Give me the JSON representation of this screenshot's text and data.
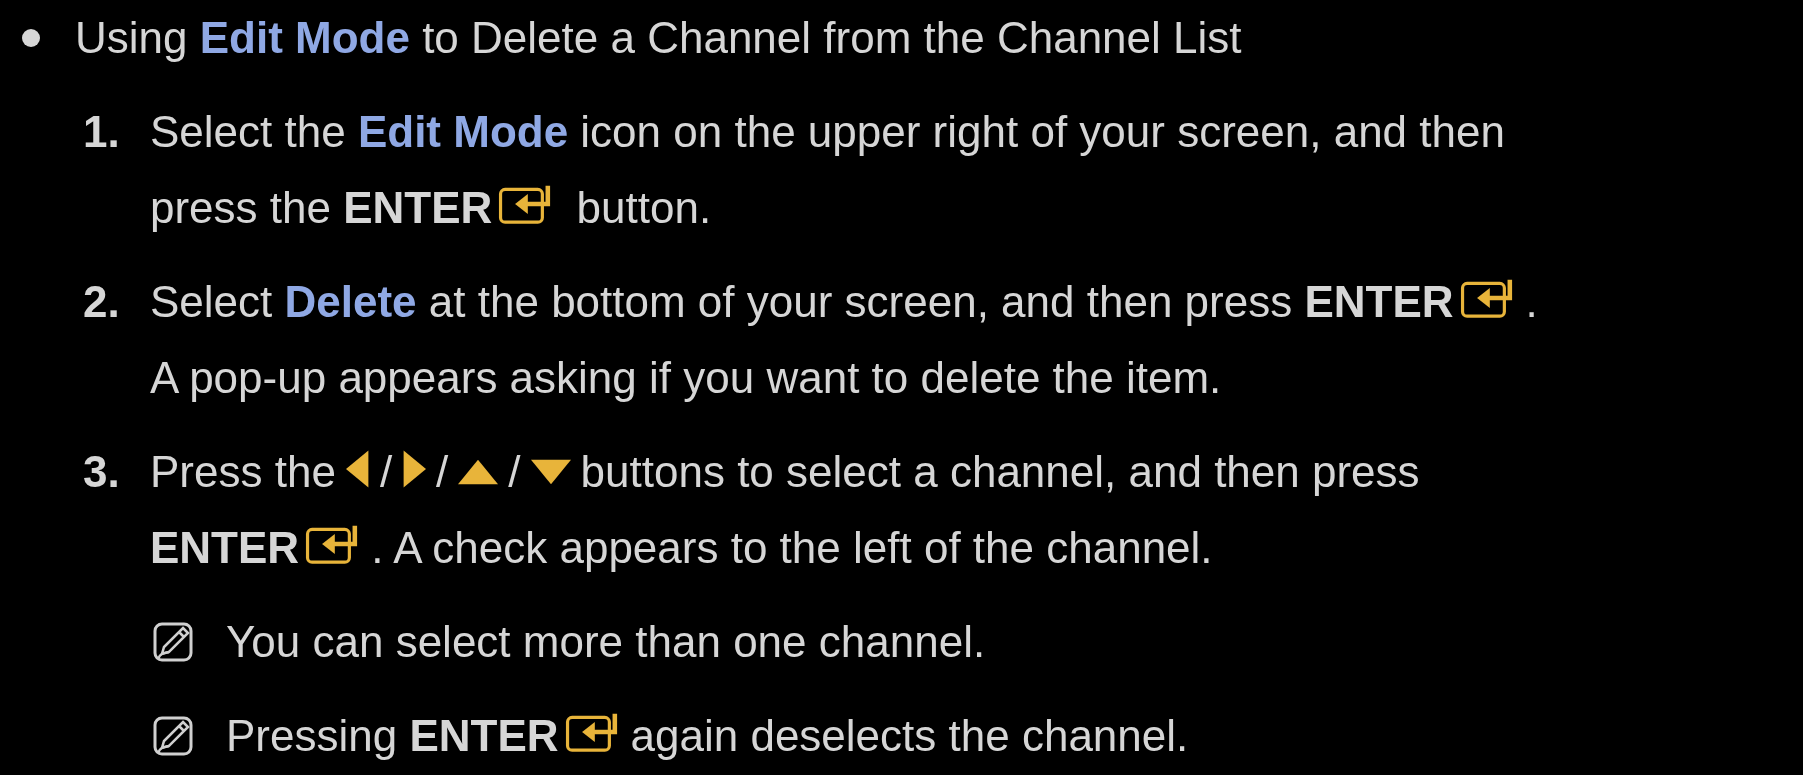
{
  "heading": {
    "parts": [
      {
        "kind": "text",
        "text": "Using "
      },
      {
        "kind": "term",
        "text": "Edit Mode"
      },
      {
        "kind": "text",
        "text": " to Delete a Channel from the Channel List"
      }
    ]
  },
  "steps": [
    {
      "number": "1.",
      "lines": [
        [
          {
            "kind": "text",
            "text": "Select the "
          },
          {
            "kind": "term",
            "text": "Edit Mode"
          },
          {
            "kind": "text",
            "text": " icon on the upper right of your screen, and then"
          }
        ],
        [
          {
            "kind": "text",
            "text": "press the **ENTER**"
          },
          {
            "kind": "enter"
          },
          {
            "kind": "text",
            "text": " button."
          }
        ]
      ]
    },
    {
      "number": "2.",
      "lines": [
        [
          {
            "kind": "text",
            "text": "Select "
          },
          {
            "kind": "term",
            "text": "Delete"
          },
          {
            "kind": "text",
            "text": " at the bottom of your screen, and then press **ENTER**"
          },
          {
            "kind": "enter"
          },
          {
            "kind": "text",
            "text": "."
          }
        ],
        [
          {
            "kind": "text",
            "text": "A pop-up appears asking if you want to delete the item."
          }
        ]
      ]
    },
    {
      "number": "3.",
      "lines": [
        [
          {
            "kind": "text",
            "text": "Press the"
          },
          {
            "kind": "left"
          },
          {
            "kind": "text",
            "text": "/"
          },
          {
            "kind": "right"
          },
          {
            "kind": "text",
            "text": "/"
          },
          {
            "kind": "up"
          },
          {
            "kind": "text",
            "text": "/"
          },
          {
            "kind": "down"
          },
          {
            "kind": "text",
            "text": "buttons to select a channel, and then press"
          }
        ],
        [
          {
            "kind": "text",
            "text": "**ENTER**"
          },
          {
            "kind": "enter"
          },
          {
            "kind": "text",
            "text": ". A check appears to the left of the channel."
          }
        ]
      ],
      "notes": [
        {
          "lines": [
            [
              {
                "kind": "text",
                "text": "You can select more than one channel."
              }
            ]
          ]
        },
        {
          "lines": [
            [
              {
                "kind": "text",
                "text": "Pressing **ENTER**"
              },
              {
                "kind": "enter"
              },
              {
                "kind": "text",
                "text": "again deselects the channel."
              }
            ]
          ]
        }
      ]
    }
  ]
}
